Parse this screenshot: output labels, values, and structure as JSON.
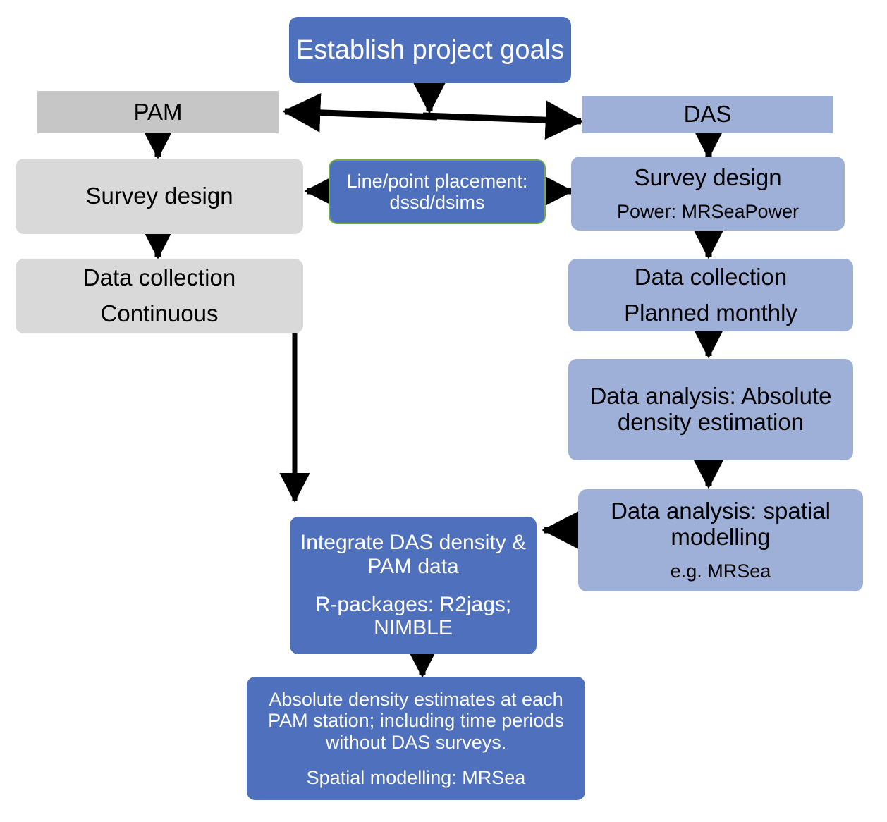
{
  "diagram": {
    "title": "Monitoring workflow flowchart",
    "colors": {
      "dark_blue": "#4e70bd",
      "light_blue": "#9eb0d8",
      "mid_gray": "#c6c6c6",
      "light_gray": "#d9d9d9",
      "green_outline": "#70ad47",
      "arrow": "#000000",
      "background": "#ffffff"
    }
  },
  "nodes": {
    "establish_goals": {
      "line1": "Establish project goals"
    },
    "pam_header": {
      "line1": "PAM"
    },
    "das_header": {
      "line1": "DAS"
    },
    "pam_survey_design": {
      "line1": "Survey design"
    },
    "line_point_placement": {
      "line1": "Line/point placement:",
      "line2": "dssd/dsims"
    },
    "das_survey_design": {
      "line1": "Survey design",
      "line2": "Power: MRSeaPower"
    },
    "pam_data_collection": {
      "line1": "Data collection",
      "line2": "Continuous"
    },
    "das_data_collection": {
      "line1": "Data collection",
      "line2": "Planned monthly"
    },
    "das_absolute_density": {
      "line1": "Data analysis: Absolute",
      "line2": "density estimation"
    },
    "das_spatial_modelling": {
      "line1": "Data analysis: spatial",
      "line2": "modelling",
      "line3": "e.g. MRSea"
    },
    "integrate": {
      "line1": "Integrate DAS density &",
      "line2": "PAM data",
      "line3": "R-packages: R2jags;",
      "line4": "NIMBLE"
    },
    "output_estimates": {
      "line1": "Absolute density estimates at each",
      "line2": "PAM station; including time periods",
      "line3": "without DAS surveys.",
      "line4": "Spatial modelling: MRSea"
    }
  },
  "connectors": [
    {
      "name": "goals-to-split",
      "from": "establish_goals",
      "to": "pam-das-split",
      "style": "arrow-down"
    },
    {
      "name": "split-to-pam",
      "from": "pam-das-split",
      "to": "pam_header",
      "style": "arrow-left"
    },
    {
      "name": "split-to-das",
      "from": "pam-das-split",
      "to": "das_header",
      "style": "arrow-right"
    },
    {
      "name": "pam-to-survey-design",
      "from": "pam_header",
      "to": "pam_survey_design",
      "style": "arrow-down"
    },
    {
      "name": "das-to-survey-design",
      "from": "das_header",
      "to": "das_survey_design",
      "style": "arrow-down"
    },
    {
      "name": "placement-to-pam-survey",
      "from": "line_point_placement",
      "to": "pam_survey_design",
      "style": "arrow-left"
    },
    {
      "name": "placement-to-das-survey",
      "from": "line_point_placement",
      "to": "das_survey_design",
      "style": "arrow-right"
    },
    {
      "name": "pam-survey-to-collection",
      "from": "pam_survey_design",
      "to": "pam_data_collection",
      "style": "arrow-down"
    },
    {
      "name": "das-survey-to-collection",
      "from": "das_survey_design",
      "to": "das_data_collection",
      "style": "arrow-down"
    },
    {
      "name": "das-collection-to-density",
      "from": "das_data_collection",
      "to": "das_absolute_density",
      "style": "arrow-down"
    },
    {
      "name": "density-to-spatial",
      "from": "das_absolute_density",
      "to": "das_spatial_modelling",
      "style": "arrow-down"
    },
    {
      "name": "pam-collection-to-integrate",
      "from": "pam_data_collection",
      "to": "integrate",
      "style": "arrow-down-long"
    },
    {
      "name": "spatial-to-integrate",
      "from": "das_spatial_modelling",
      "to": "integrate",
      "style": "arrow-left"
    },
    {
      "name": "integrate-to-output",
      "from": "integrate",
      "to": "output_estimates",
      "style": "arrow-down"
    }
  ]
}
